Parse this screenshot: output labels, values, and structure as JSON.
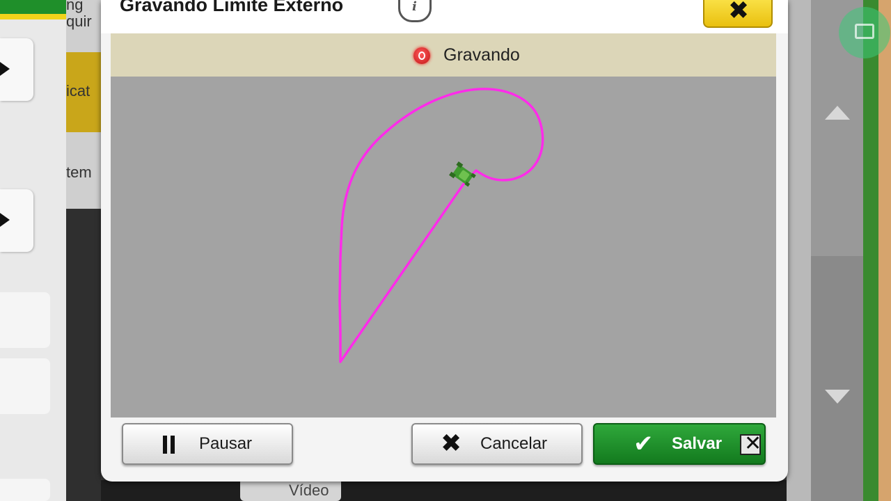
{
  "dialog": {
    "title": "Gravando Limite Externo",
    "info_icon": "info-icon",
    "close_icon": "close-icon"
  },
  "status": {
    "text": "Gravando",
    "indicator_color": "#d81c1c"
  },
  "map": {
    "boundary_color": "#ff2bea",
    "background_color": "#a3a3a3",
    "vehicle_icon": "tractor-icon"
  },
  "buttons": {
    "pause": {
      "label": "Pausar",
      "icon": "pause-icon"
    },
    "cancel": {
      "label": "Cancelar",
      "icon": "x-icon"
    },
    "save": {
      "label": "Salvar",
      "icon": "check-icon",
      "color": "#1f8f2a"
    }
  },
  "background": {
    "left_fragments": [
      "ng",
      "quir",
      "icat",
      "tem"
    ],
    "bottom_tab": "Vídeo"
  }
}
